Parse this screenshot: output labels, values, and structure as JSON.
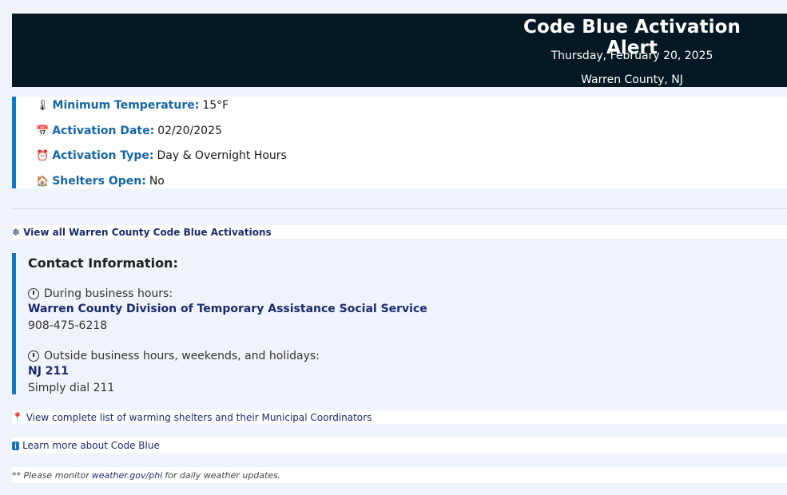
{
  "header": {
    "title": "Code Blue Activation Alert",
    "date": "Thursday, February 20, 2025",
    "location": "Warren County, NJ"
  },
  "details": [
    {
      "icon": "thermometer-icon",
      "label": "Minimum Temperature:",
      "value": "15°F"
    },
    {
      "icon": "calendar-icon",
      "label": "Activation Date:",
      "value": "02/20/2025"
    },
    {
      "icon": "alarm-clock-icon",
      "label": "Activation Type:",
      "value": "Day & Overnight Hours"
    },
    {
      "icon": "house-icon",
      "label": "Shelters Open:",
      "value": "No"
    }
  ],
  "links": {
    "view_all": "View all Warren County Code Blue Activations",
    "warming_shelters": "View complete list of warming shelters and their Municipal Coordinators",
    "learn_more": "Learn more about Code Blue"
  },
  "contact": {
    "title": "Contact Information:",
    "business_label": "During business hours:",
    "business_org": "Warren County Division of Temporary Assistance Social Service",
    "business_phone": "908-475-6218",
    "after_label": "Outside business hours, weekends, and holidays:",
    "after_org": "NJ 211",
    "after_phone": "Simply dial 211"
  },
  "footer": {
    "prefix": "** Please monitor",
    "link": "weather.gov/phi",
    "suffix": "for daily weather updates."
  },
  "colors": {
    "header_bg": "#041924",
    "accent": "#1177c8",
    "label_blue": "#1566a8",
    "link_navy": "#1b2a6e"
  }
}
